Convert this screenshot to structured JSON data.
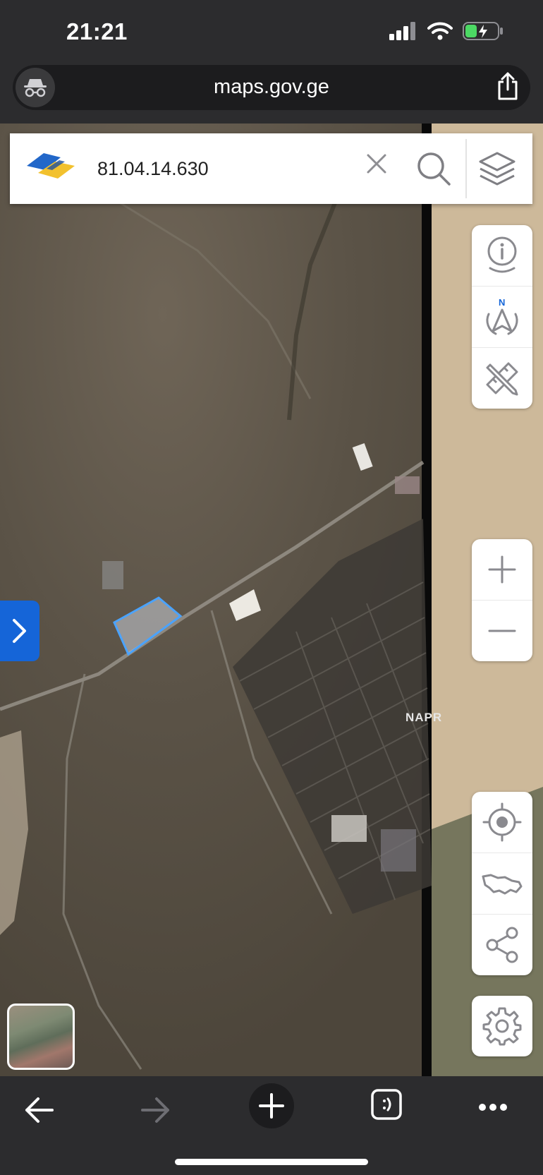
{
  "status_bar": {
    "time": "21:21"
  },
  "browser": {
    "url": "maps.gov.ge"
  },
  "search": {
    "value": "81.04.14.630",
    "placeholder": ""
  },
  "map": {
    "label": "NAPR"
  },
  "colors": {
    "accent": "#1565d8",
    "parcel_outline": "#4aa3ff",
    "logo_blue": "#2267c9",
    "logo_yellow": "#f2c12e"
  },
  "icons": {
    "url_left": "incognito-icon",
    "share": "share-icon",
    "clear": "close-icon",
    "search": "search-icon",
    "layers": "layers-icon",
    "info": "info-pin-icon",
    "compass": "compass-north-icon",
    "measure": "ruler-pencil-icon",
    "zoom_in": "plus-icon",
    "zoom_out": "minus-icon",
    "locate": "locate-icon",
    "country": "georgia-map-icon",
    "share_map": "share-nodes-icon",
    "settings": "gear-icon",
    "expand": "chevron-right-icon",
    "back": "arrow-left-icon",
    "forward": "arrow-right-icon",
    "new_tab": "plus-icon",
    "tabs": "tabs-icon",
    "more": "more-icon"
  }
}
